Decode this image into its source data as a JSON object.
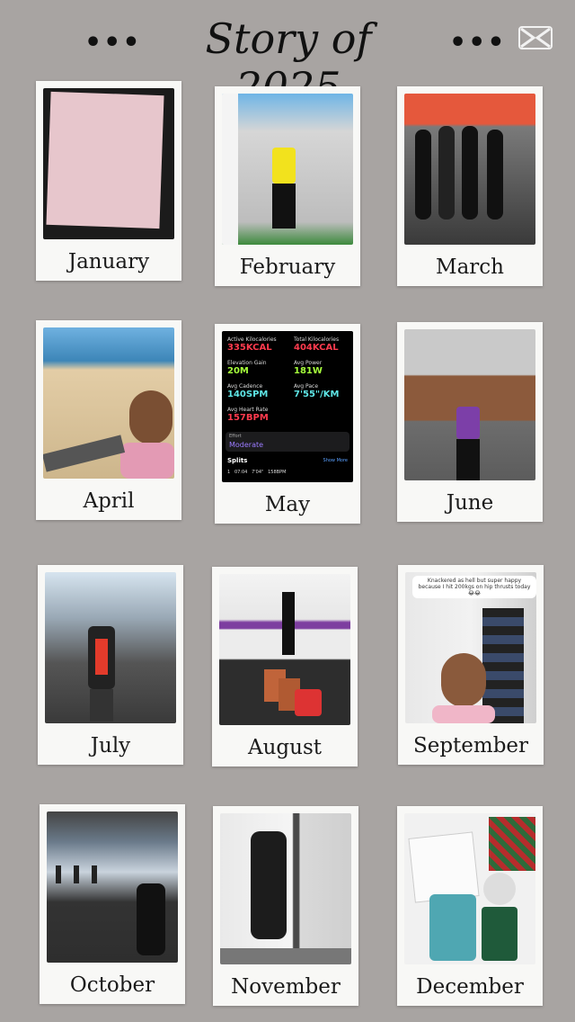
{
  "header": {
    "title": "Story of 2025",
    "dots_left": "•••",
    "dots_right": "•••",
    "logo_icon": "capcut-logo-icon"
  },
  "months": [
    {
      "label": "January"
    },
    {
      "label": "February"
    },
    {
      "label": "March"
    },
    {
      "label": "April"
    },
    {
      "label": "May"
    },
    {
      "label": "June"
    },
    {
      "label": "July"
    },
    {
      "label": "August"
    },
    {
      "label": "September"
    },
    {
      "label": "October"
    },
    {
      "label": "November"
    },
    {
      "label": "December"
    }
  ],
  "may_stats": {
    "active_kcal_label": "Active Kilocalories",
    "active_kcal_value": "335KCAL",
    "total_kcal_label": "Total Kilocalories",
    "total_kcal_value": "404KCAL",
    "elevation_label": "Elevation Gain",
    "elevation_value": "20M",
    "power_label": "Avg Power",
    "power_value": "181W",
    "cadence_label": "Avg Cadence",
    "cadence_value": "140SPM",
    "pace_label": "Avg Pace",
    "pace_value": "7'55\"/KM",
    "hr_label": "Avg Heart Rate",
    "hr_value": "157BPM",
    "effort_label": "Effort",
    "effort_value": "Moderate",
    "splits_label": "Splits",
    "show_more": "Show More",
    "split_row": "1   07:04   7'04\"   158BPM"
  },
  "september_caption": "Knackered as hell but super happy because I hit 200kgs on hip thrusts today 😂😂",
  "colors": {
    "background": "#a8a4a2",
    "card": "#f8f8f6",
    "stat_red": "#ff3b4e",
    "stat_green": "#a6ff3c",
    "stat_teal": "#5ee6e6"
  }
}
